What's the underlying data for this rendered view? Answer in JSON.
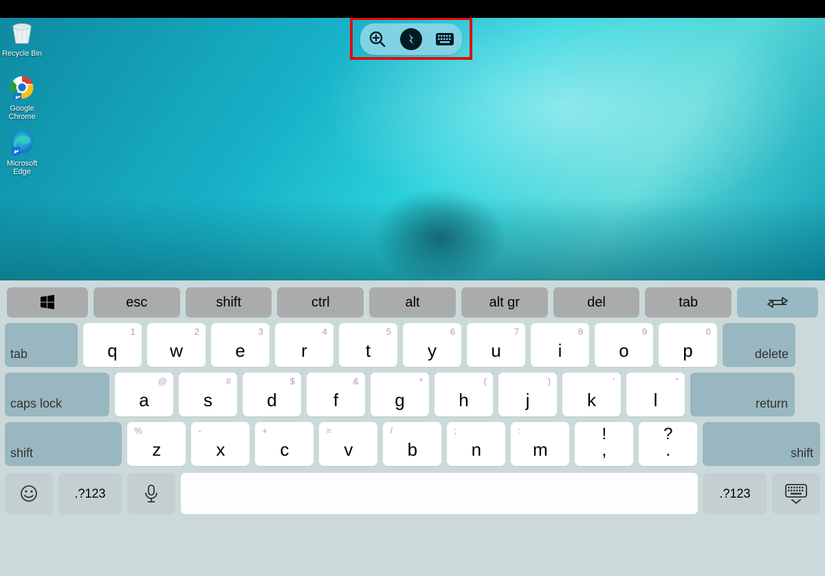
{
  "desktop_icons": [
    {
      "label": "Recycle Bin"
    },
    {
      "label": "Google Chrome"
    },
    {
      "label": "Microsoft Edge"
    }
  ],
  "toolbar": {
    "zoom": "zoom-in-icon",
    "connection": "connection-icon",
    "keyboard": "keyboard-icon"
  },
  "top_row": {
    "windows": "",
    "keys": [
      "esc",
      "shift",
      "ctrl",
      "alt",
      "alt gr",
      "del",
      "tab"
    ]
  },
  "row1": {
    "left": "tab",
    "keys": [
      {
        "l": "q",
        "h": "1"
      },
      {
        "l": "w",
        "h": "2"
      },
      {
        "l": "e",
        "h": "3"
      },
      {
        "l": "r",
        "h": "4"
      },
      {
        "l": "t",
        "h": "5"
      },
      {
        "l": "y",
        "h": "6"
      },
      {
        "l": "u",
        "h": "7"
      },
      {
        "l": "i",
        "h": "8"
      },
      {
        "l": "o",
        "h": "9"
      },
      {
        "l": "p",
        "h": "0"
      }
    ],
    "right": "delete"
  },
  "row2": {
    "left": "caps lock",
    "keys": [
      {
        "l": "a",
        "h": "@"
      },
      {
        "l": "s",
        "h": "#"
      },
      {
        "l": "d",
        "h": "$"
      },
      {
        "l": "f",
        "h": "&"
      },
      {
        "l": "g",
        "h": "*"
      },
      {
        "l": "h",
        "h": "("
      },
      {
        "l": "j",
        "h": ")"
      },
      {
        "l": "k",
        "h": "'"
      },
      {
        "l": "l",
        "h": "\""
      }
    ],
    "right": "return"
  },
  "row3": {
    "left": "shift",
    "keys": [
      {
        "l": "z",
        "h": "%"
      },
      {
        "l": "x",
        "h": "-"
      },
      {
        "l": "c",
        "h": "+"
      },
      {
        "l": "v",
        "h": "="
      },
      {
        "l": "b",
        "h": "/"
      },
      {
        "l": "n",
        "h": ";"
      },
      {
        "l": "m",
        "h": ":"
      },
      {
        "l": ",",
        "h": "!",
        "big": true
      },
      {
        "l": ".",
        "h": "?",
        "big": true
      }
    ],
    "right": "shift"
  },
  "row4": {
    "nums": ".?123"
  }
}
